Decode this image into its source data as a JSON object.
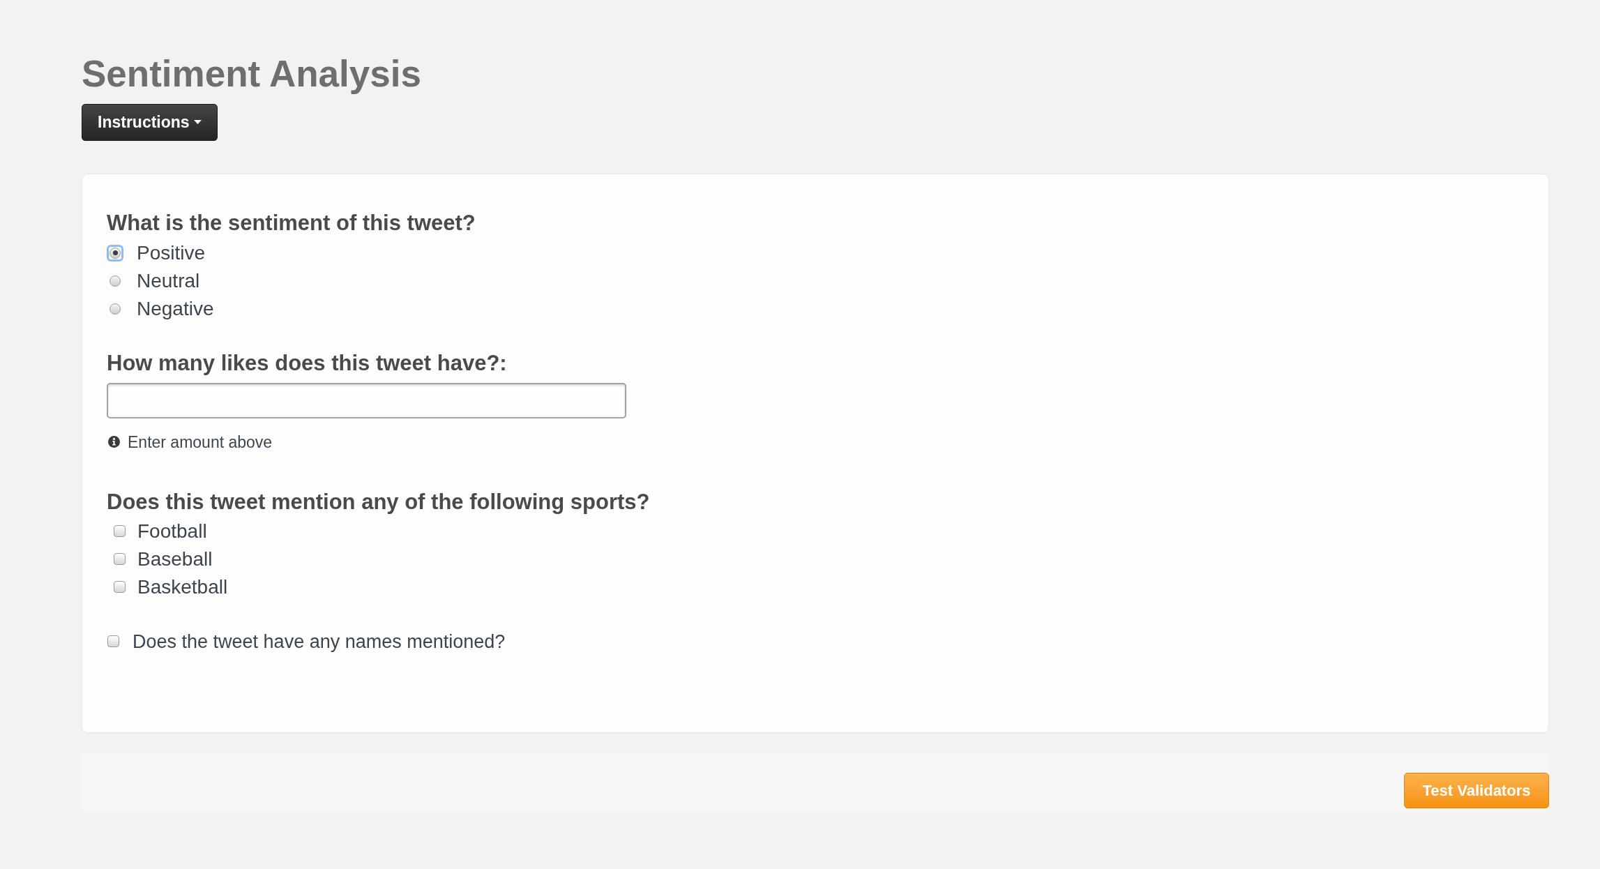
{
  "title": "Sentiment Analysis",
  "instructions_button": {
    "label": "Instructions"
  },
  "form": {
    "fields": [
      {
        "kind": "radio",
        "question": "What is the sentiment of this tweet?",
        "options": [
          {
            "label": "Positive",
            "selected": true,
            "focused": true
          },
          {
            "label": "Neutral",
            "selected": false,
            "focused": false
          },
          {
            "label": "Negative",
            "selected": false,
            "focused": false
          }
        ]
      },
      {
        "kind": "text",
        "question": "How many likes does this tweet have?:",
        "hint": "Enter amount above"
      },
      {
        "kind": "checkboxes",
        "question": "Does this tweet mention any of the following sports?",
        "options": [
          {
            "label": "Football",
            "checked": false
          },
          {
            "label": "Baseball",
            "checked": false
          },
          {
            "label": "Basketball",
            "checked": false
          }
        ]
      },
      {
        "kind": "checkbox",
        "label": "Does the tweet have any names mentioned?",
        "checked": false
      }
    ]
  },
  "test_button": {
    "label": "Test Validators"
  }
}
